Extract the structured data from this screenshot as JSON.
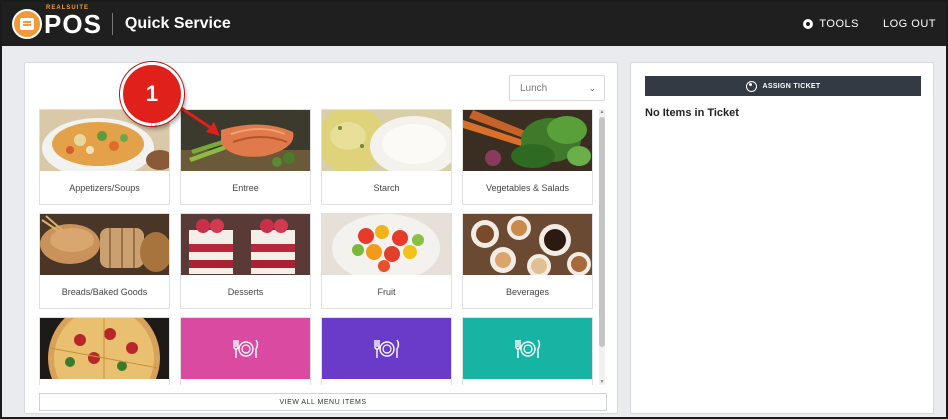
{
  "header": {
    "logo_sub": "REALSUITE",
    "logo_text": "POS",
    "title": "Quick Service",
    "tools_label": "TOOLS",
    "logout_label": "LOG OUT"
  },
  "menu": {
    "meal_period": "Lunch",
    "view_all_label": "VIEW ALL MENU ITEMS",
    "categories": [
      {
        "label": "Appetizers/Soups"
      },
      {
        "label": "Entree"
      },
      {
        "label": "Starch"
      },
      {
        "label": "Vegetables & Salads"
      },
      {
        "label": "Breads/Baked Goods"
      },
      {
        "label": "Desserts"
      },
      {
        "label": "Fruit"
      },
      {
        "label": "Beverages"
      },
      {
        "label": ""
      },
      {
        "label": ""
      },
      {
        "label": ""
      },
      {
        "label": ""
      }
    ]
  },
  "ticket": {
    "assign_label": "ASSIGN TICKET",
    "empty_message": "No Items in Ticket"
  },
  "annotation": {
    "step_number": "1"
  },
  "colors": {
    "header_bg": "#1f1f1f",
    "logo_orange": "#f29a3a",
    "tile_pink": "#d94aa0",
    "tile_purple": "#6a3bc9",
    "tile_teal": "#17b3a3",
    "assign_button": "#343a44",
    "callout_red": "#e0211b"
  }
}
